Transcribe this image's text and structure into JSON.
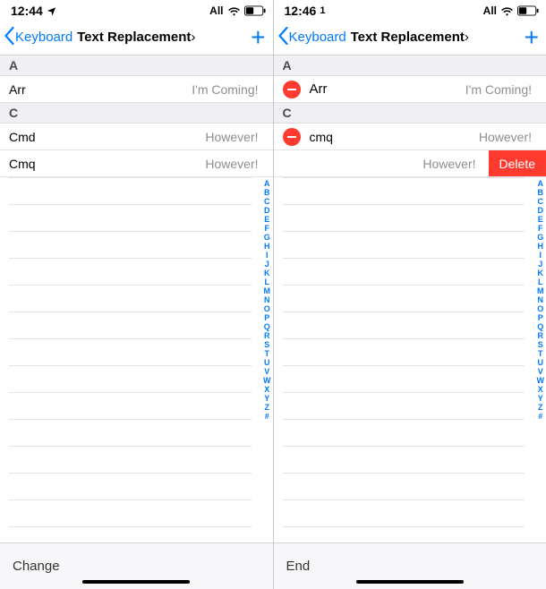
{
  "alpha_index": [
    "A",
    "B",
    "C",
    "D",
    "E",
    "F",
    "G",
    "H",
    "I",
    "J",
    "K",
    "L",
    "M",
    "N",
    "O",
    "P",
    "Q",
    "R",
    "S",
    "T",
    "U",
    "V",
    "W",
    "X",
    "Y",
    "Z",
    "#"
  ],
  "left": {
    "status": {
      "time": "12:44",
      "net_label": "All"
    },
    "nav": {
      "back_label": "Keyboard",
      "title": "Text Replacement",
      "title_chevron": "›"
    },
    "sections": {
      "a_header": "A",
      "a_rows": [
        {
          "shortcut": "Arr",
          "phrase": "I'm Coming!"
        }
      ],
      "c_header": "C",
      "c_rows": [
        {
          "shortcut": "Cmd",
          "phrase": "However!"
        },
        {
          "shortcut": "Cmq",
          "phrase": "However!"
        }
      ]
    },
    "footer_label": "Change"
  },
  "right": {
    "status": {
      "time": "12:46",
      "net_label": "All"
    },
    "nav": {
      "back_label": "Keyboard",
      "title": "Text Replacement",
      "title_chevron": "›"
    },
    "sections": {
      "a_header": "A",
      "a_rows": [
        {
          "shortcut": "Arr",
          "phrase": "I'm Coming!",
          "edit": true
        }
      ],
      "c_header": "C",
      "c_rows": [
        {
          "shortcut": "cmq",
          "phrase": "However!",
          "edit": true
        },
        {
          "shortcut": "",
          "phrase": "However!",
          "swiped": true,
          "delete_label": "Delete"
        }
      ]
    },
    "footer_label": "End"
  }
}
